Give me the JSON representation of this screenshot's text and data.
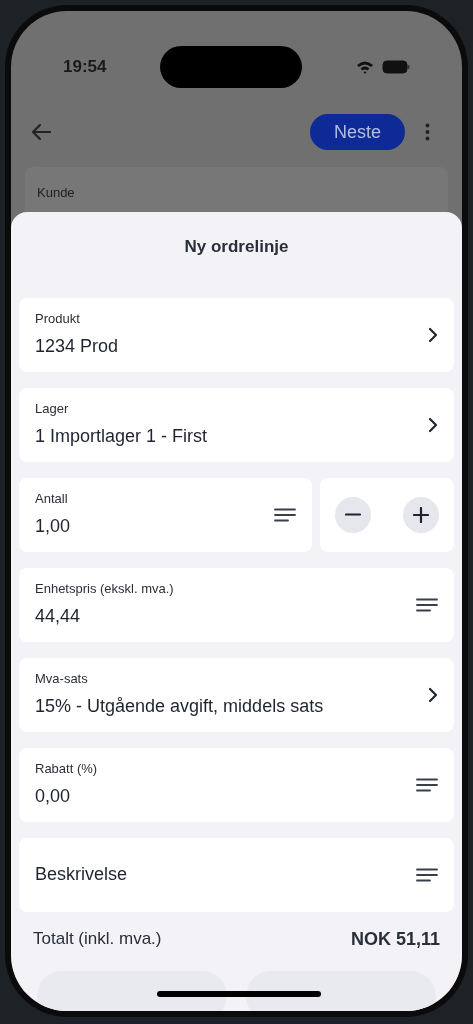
{
  "status_bar": {
    "time": "19:54"
  },
  "header": {
    "next_button": "Neste"
  },
  "background_card": {
    "label": "Kunde"
  },
  "sheet": {
    "title": "Ny ordrelinje",
    "fields": [
      {
        "kind": "select",
        "label": "Produkt",
        "value": "1234 Prod"
      },
      {
        "kind": "select",
        "label": "Lager",
        "value": "1 Importlager 1 - First"
      },
      {
        "kind": "quantity",
        "label": "Antall",
        "value": "1,00"
      },
      {
        "kind": "text",
        "label": "Enhetspris (ekskl. mva.)",
        "value": "44,44"
      },
      {
        "kind": "select",
        "label": "Mva-sats",
        "value": "15% - Utgående avgift, middels sats"
      },
      {
        "kind": "text",
        "label": "Rabatt (%)",
        "value": "0,00"
      },
      {
        "kind": "text_empty",
        "label": "Beskrivelse"
      }
    ],
    "total": {
      "label": "Totalt (inkl. mva.)",
      "value": "NOK 51,11"
    }
  }
}
